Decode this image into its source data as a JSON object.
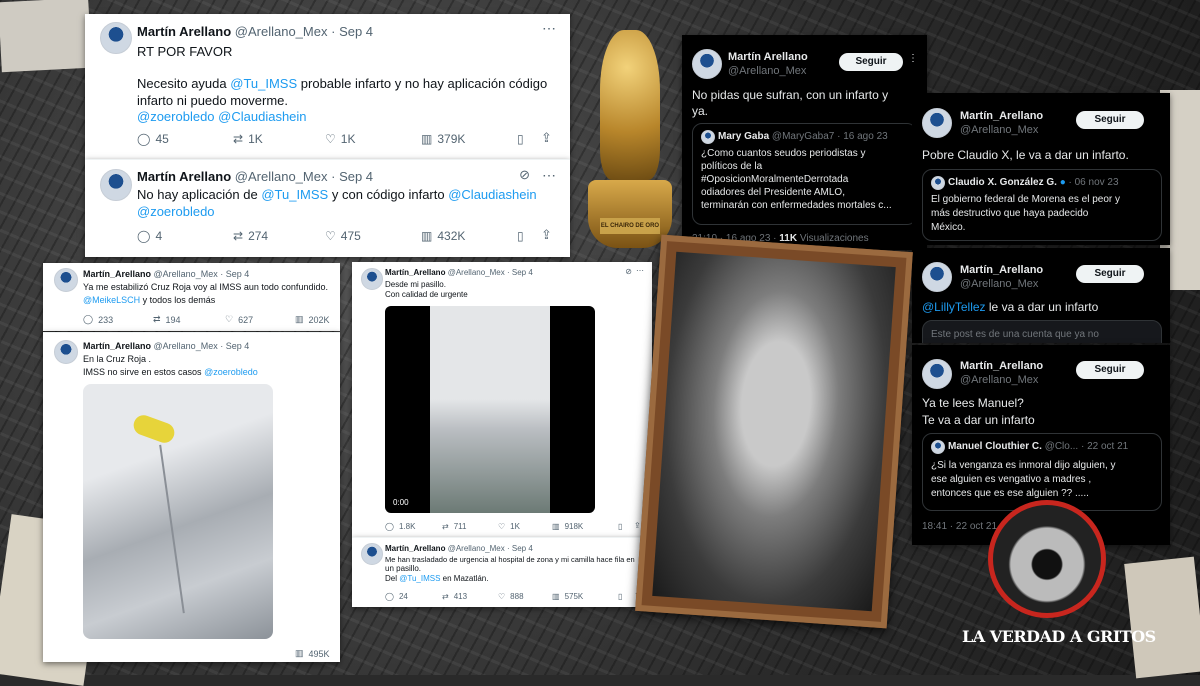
{
  "logo": {
    "text": "LA VERDAD A GRITOS"
  },
  "trophy": {
    "text": "EL CHAIRO DE ORO"
  },
  "tweet_a": {
    "name": "Martín Arellano",
    "handle": "@Arellano_Mex",
    "dot": "·",
    "date": "Sep 4",
    "line1": "RT POR FAVOR",
    "line2_pre": "Necesito ayuda",
    "line2_mention": "@Tu_IMSS",
    "line2_post": "probable infarto y no hay aplicación código",
    "line3": "infarto ni puedo moverme.",
    "line4_a": "@zoerobledo",
    "line4_b": "@Claudiashein",
    "replies": "45",
    "retweets": "1K",
    "likes": "1K",
    "views": "379K"
  },
  "tweet_b": {
    "name": "Martín Arellano",
    "handle": "@Arellano_Mex",
    "dot": "·",
    "date": "Sep 4",
    "line1_pre": "No hay aplicación de",
    "line1_mention": "@Tu_IMSS",
    "line1_post": "y con código infarto",
    "line1_mention2": "@Claudiashein",
    "line2": "@zoerobledo",
    "replies": "4",
    "retweets": "274",
    "likes": "475",
    "views": "432K"
  },
  "tweet_c": {
    "name": "Martín_Arellano",
    "handle": "@Arellano_Mex",
    "dot": "·",
    "date": "Sep 4",
    "line1": "Ya me estabilizó Cruz Roja voy al IMSS aun todo confundido.",
    "line2_mention": "@MeikeLSCH",
    "line2_post": "y todos los demás",
    "replies": "233",
    "retweets": "194",
    "likes": "627",
    "views": "202K"
  },
  "tweet_d": {
    "name": "Martín_Arellano",
    "handle": "@Arellano_Mex",
    "dot": "·",
    "date": "Sep 4",
    "line1": "En la Cruz Roja .",
    "line2_pre": "IMSS no sirve en estos casos",
    "line2_mention": "@zoerobledo",
    "views": "495K"
  },
  "tweet_e": {
    "name": "Martín_Arellano",
    "handle": "@Arellano_Mex",
    "dot": "·",
    "date": "Sep 4",
    "line1": "Desde mi pasillo.",
    "line2": "Con calidad de urgente",
    "video_time": "0:00",
    "replies": "1.8K",
    "retweets": "711",
    "likes": "1K",
    "views": "918K"
  },
  "tweet_f": {
    "name": "Martín_Arellano",
    "handle": "@Arellano_Mex",
    "dot": "·",
    "date": "Sep 4",
    "line1": "Me han trasladado de urgencia al hospital de zona y mi camilla hace fila en",
    "line2": "un pasillo.",
    "line3_pre": "Del",
    "line3_mention": "@Tu_IMSS",
    "line3_post": "en Mazatlán.",
    "replies": "24",
    "retweets": "413",
    "likes": "888",
    "views": "575K"
  },
  "tweet_g": {
    "name": "Martín Arellano",
    "handle": "@Arellano_Mex",
    "follow": "Seguir",
    "line1": "No pidas que sufran, con un infarto y",
    "line2": "ya.",
    "quote_name": "Mary Gaba",
    "quote_handle": "@MaryGaba7",
    "quote_date": "· 16 ago 23",
    "quote_lines": [
      "¿Como cuantos seudos  periodistas y",
      "políticos de la",
      "#OposicionMoralmenteDerrotada",
      "odiadores del Presidente AMLO,",
      "terminarán con enfermedades mortales c..."
    ],
    "footer_time": "21:10 · 16 ago 23 ·",
    "footer_views": "11K",
    "footer_label": "Visualizaciones"
  },
  "tweet_h": {
    "name": "Martín_Arellano",
    "handle": "@Arellano_Mex",
    "follow": "Seguir",
    "line1": "Pobre Claudio X, le va a dar un infarto.",
    "quote_name": "Claudio X. González G.",
    "quote_date": "· 06 nov 23",
    "quote_lines": [
      "El gobierno federal de Morena es el peor y",
      "más destructivo que haya padecido",
      "México."
    ]
  },
  "tweet_i": {
    "name": "Martín_Arellano",
    "handle": "@Arellano_Mex",
    "follow": "Seguir",
    "line1_mention": "@LillyTellez",
    "line1_post": "le va a dar un infarto",
    "notice": "Este post es de una cuenta que ya no"
  },
  "tweet_j": {
    "name": "Martín_Arellano",
    "handle": "@Arellano_Mex",
    "follow": "Seguir",
    "line1": "Ya te lees Manuel?",
    "line2": "Te va a dar un infarto",
    "quote_name": "Manuel Clouthier C.",
    "quote_handle": "@Clo...",
    "quote_date": "· 22 oct 21",
    "quote_lines": [
      "¿Si la venganza es inmoral dijo alguien, y",
      "ese alguien es vengativo a madres ,",
      "entonces que es ese alguien ?? ....."
    ],
    "footer_time": "18:41 · 22 oct 21"
  },
  "colors": {
    "link": "#1d9bf0",
    "logo_ring": "#c8261e",
    "frame": "#9b6a3f"
  }
}
